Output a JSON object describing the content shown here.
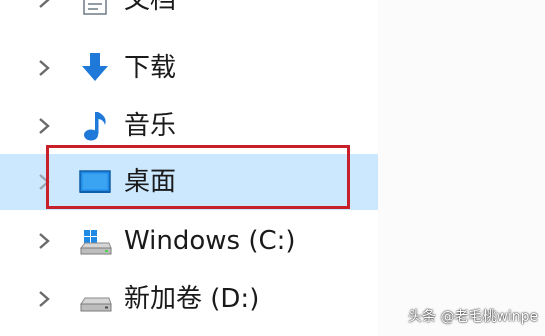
{
  "nav_tree": {
    "items": [
      {
        "label": "文档",
        "icon": "document-icon"
      },
      {
        "label": "下载",
        "icon": "download-icon"
      },
      {
        "label": "音乐",
        "icon": "music-note-icon"
      },
      {
        "label": "桌面",
        "icon": "desktop-icon",
        "selected": true
      },
      {
        "label": "Windows (C:)",
        "icon": "windows-drive-icon"
      },
      {
        "label": "新加卷 (D:)",
        "icon": "drive-icon"
      }
    ]
  },
  "watermark": "头条 @老毛桃winpe",
  "colors": {
    "selection_bg": "#cce8ff",
    "highlight_border": "#c8202a",
    "download_arrow": "#1e79d9",
    "music_note": "#1e79d9",
    "desktop_screen": "#1e8ae6"
  }
}
